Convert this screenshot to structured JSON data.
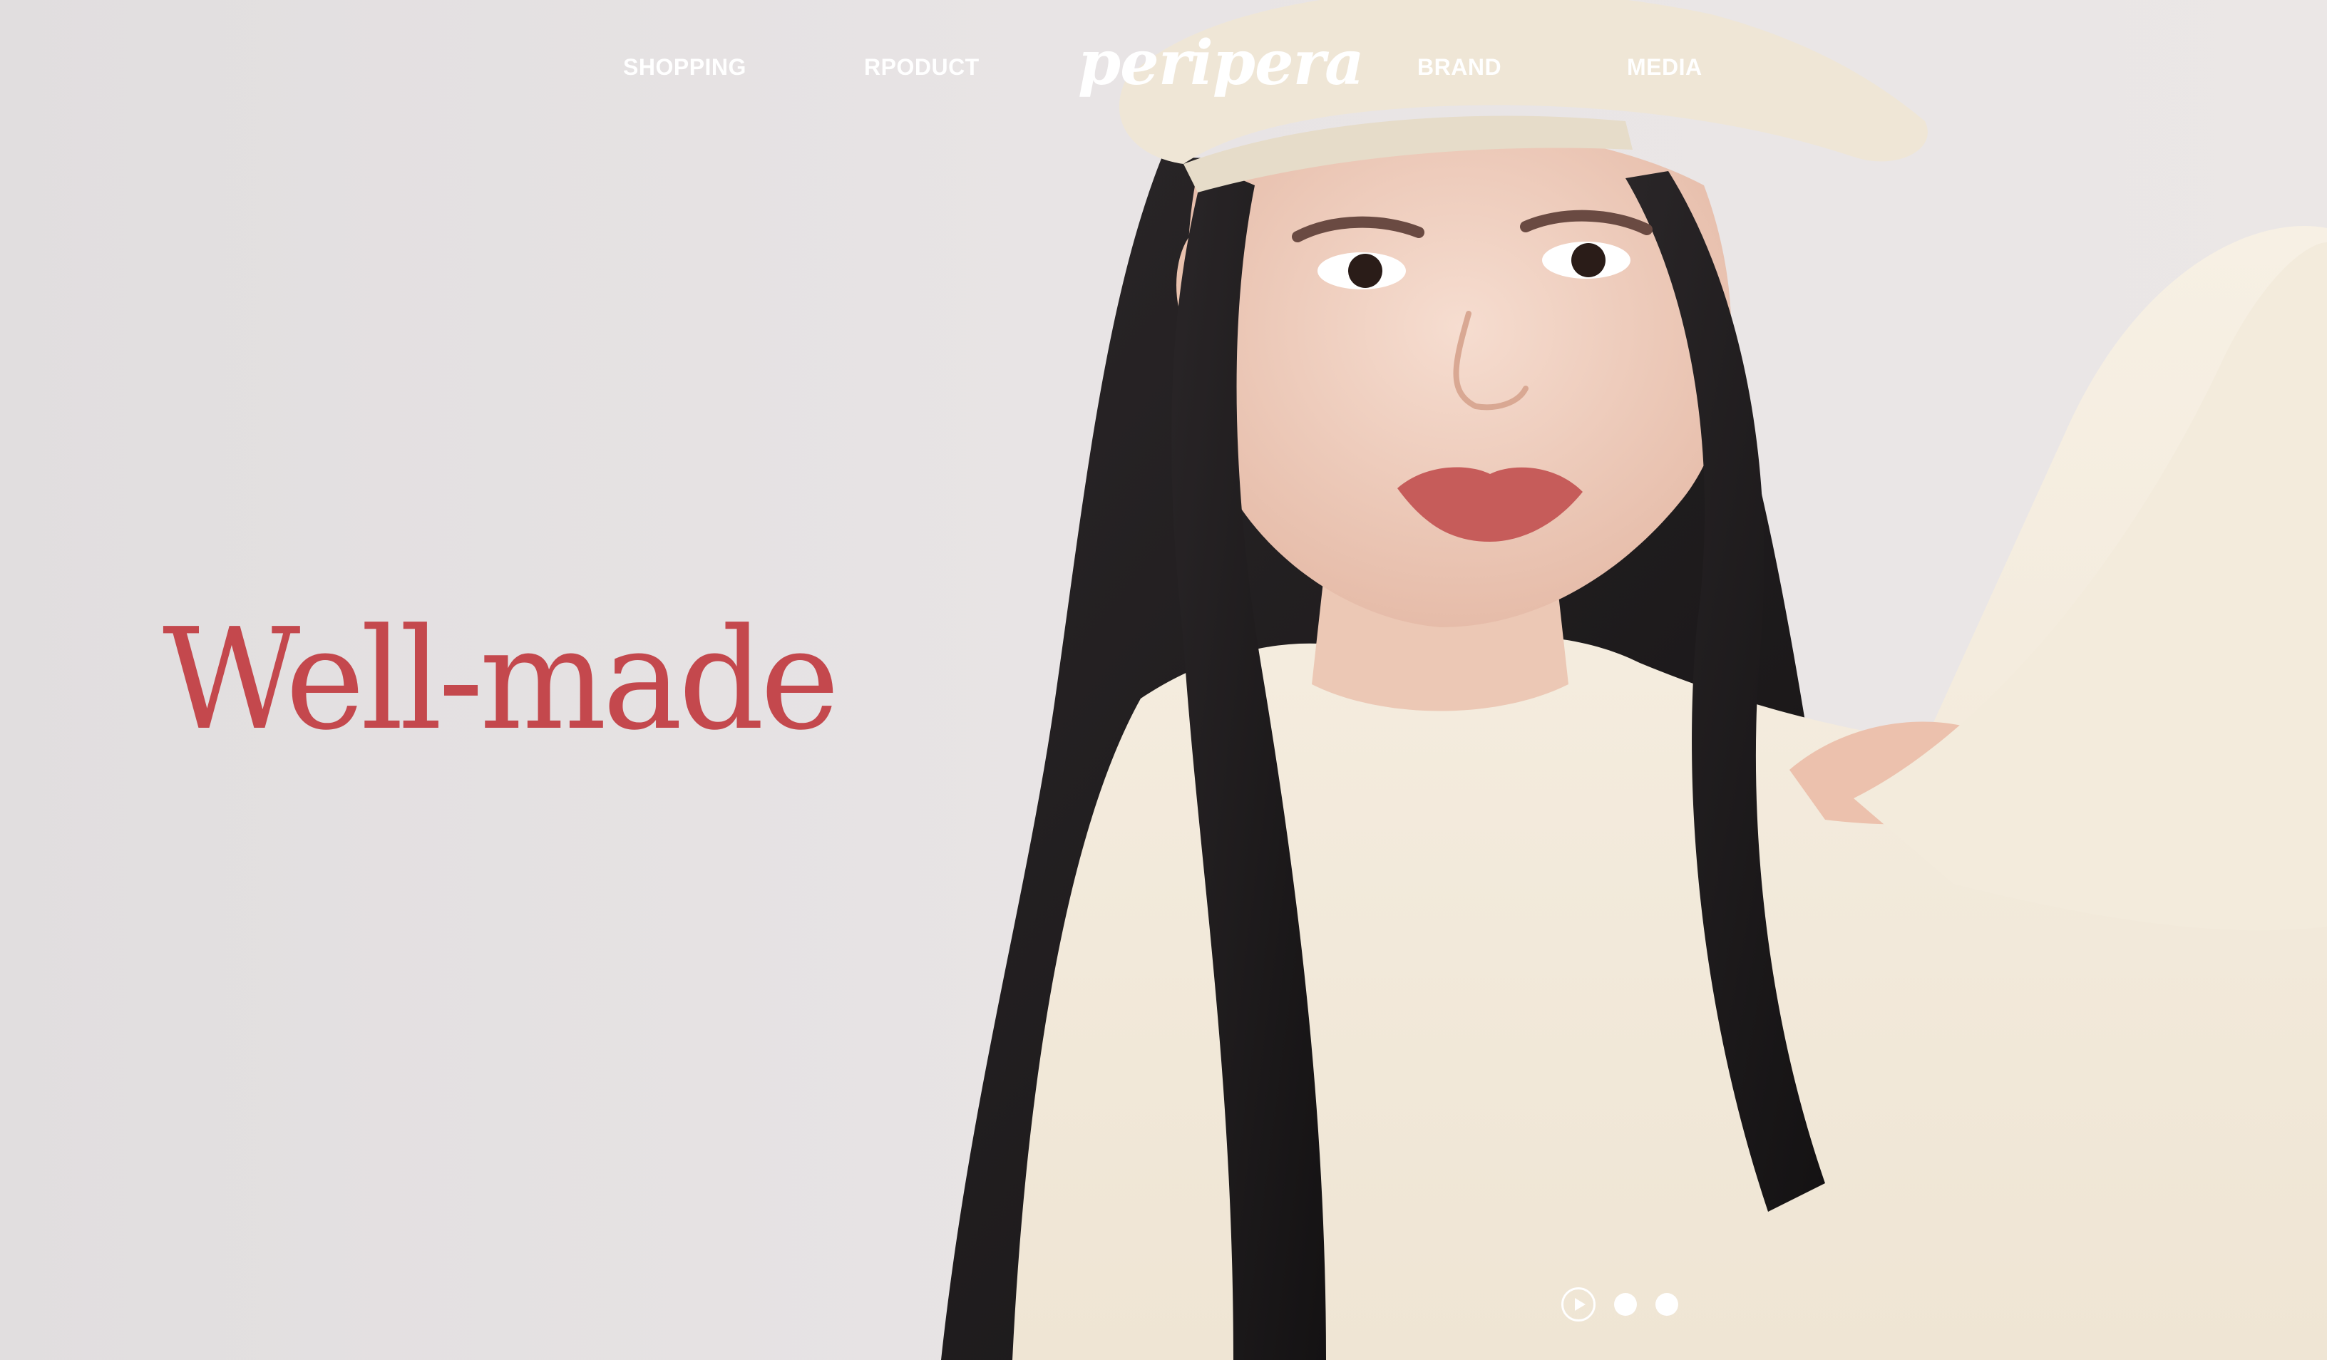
{
  "nav": {
    "items": [
      {
        "label": "SHOPPING"
      },
      {
        "label": "RPODUCT"
      },
      {
        "label": "BRAND"
      },
      {
        "label": "MEDIA"
      }
    ],
    "logo": "peripera"
  },
  "hero": {
    "headline": "Well-made",
    "headline_color": "#c4484d",
    "background_color": "#e6e2e3",
    "image": "model-in-beret-and-cream-sweater"
  },
  "slider": {
    "controls": [
      "play-icon",
      "slide-dot",
      "slide-dot"
    ]
  }
}
